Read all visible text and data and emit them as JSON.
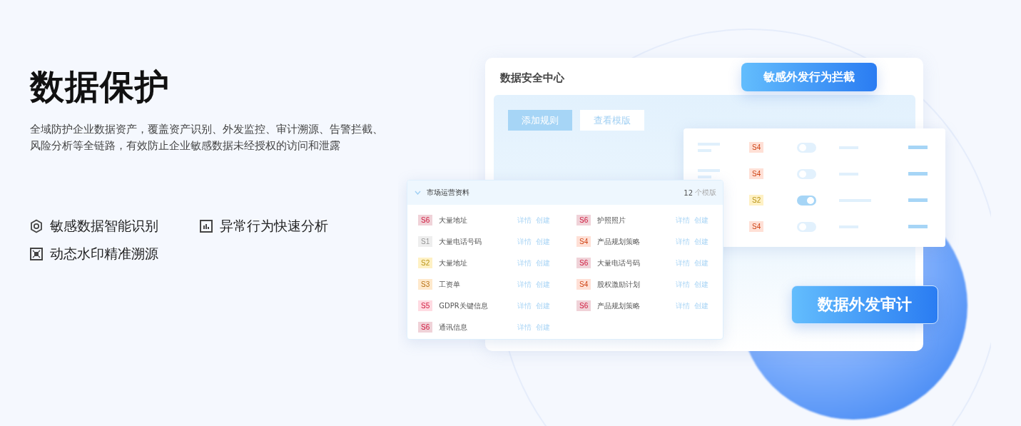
{
  "intro": {
    "title": "数据保护",
    "description": "全域防护企业数据资产，覆盖资产识别、外发监控、审计溯源、告警拦截、风险分析等全链路，有效防止企业敏感数据未经授权的访问和泄露",
    "features": [
      {
        "kind": "hexagon",
        "label": "敏感数据智能识别"
      },
      {
        "kind": "chart",
        "label": "异常行为快速分析"
      },
      {
        "kind": "frame",
        "label": "动态水印精准溯源"
      }
    ]
  },
  "panel": {
    "title": "数据安全中心",
    "buttons": [
      {
        "label": "添加规则",
        "selected": true
      },
      {
        "label": "查看模版",
        "selected": false
      }
    ]
  },
  "badges": [
    "敏感外发行为拦截",
    "数据外发审计"
  ],
  "toggle_rows": [
    {
      "level": "S4",
      "color": "#ffe0d6",
      "on": false
    },
    {
      "level": "S4",
      "color": "#ffe0d6",
      "on": false
    },
    {
      "level": "S2",
      "color": "#fff1c4",
      "on": true
    },
    {
      "level": "S4",
      "color": "#ffe0d6",
      "on": false
    }
  ],
  "list": {
    "title": "市场运营资料",
    "expanded": true,
    "count": "12",
    "count_unit": "个模版",
    "items": [
      {
        "level": "S6",
        "color": "#f0d2d8",
        "name": "大量地址",
        "actions": [
          "详情",
          "创建"
        ]
      },
      {
        "level": "S6",
        "color": "#f0d2d8",
        "name": "护照照片",
        "actions": [
          "详情",
          "创建"
        ]
      },
      {
        "level": "S1",
        "color": "#eeeeee",
        "name": "大量电话号码",
        "actions": [
          "详情",
          "创建"
        ]
      },
      {
        "level": "S4",
        "color": "#ffe0d6",
        "name": "产品规划策略",
        "actions": [
          "详情",
          "创建"
        ]
      },
      {
        "level": "S2",
        "color": "#fff1c4",
        "name": "大量地址",
        "actions": [
          "详情",
          "创建"
        ]
      },
      {
        "level": "S6",
        "color": "#f0d2d8",
        "name": "大量电话号码",
        "actions": [
          "详情",
          "创建"
        ]
      },
      {
        "level": "S3",
        "color": "#ffe9cc",
        "name": "工资单",
        "actions": [
          "详情",
          "创建"
        ]
      },
      {
        "level": "S4",
        "color": "#ffe0d6",
        "name": "股权激励计划",
        "actions": [
          "详情",
          "创建"
        ]
      },
      {
        "level": "S5",
        "color": "#ffdbe2",
        "name": "GDPR关键信息",
        "actions": [
          "详情",
          "创建"
        ]
      },
      {
        "level": "S6",
        "color": "#f0d2d8",
        "name": "产品规划策略",
        "actions": [
          "详情",
          "创建"
        ]
      },
      {
        "level": "S6",
        "color": "#f0d2d8",
        "name": "通讯信息",
        "actions": [
          "详情",
          "创建"
        ]
      }
    ]
  }
}
